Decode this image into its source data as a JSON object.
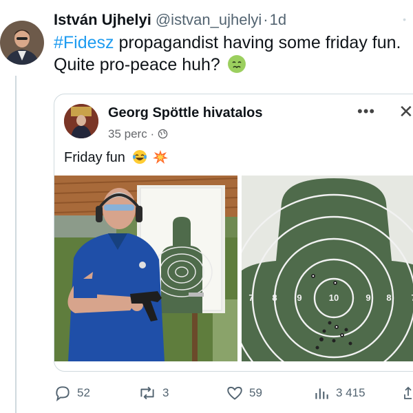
{
  "tweet": {
    "author": "István Ujhelyi",
    "handle": "@istvan_ujhelyi",
    "separator": "·",
    "time": "1d",
    "hashtag": "#Fidesz",
    "text_line": " propagandist having some friday fun. Quite pro-peace huh?",
    "emoji": "nauseated-face-emoji"
  },
  "embedded_post": {
    "author": "Georg Spöttle hivatalos",
    "time": "35 perc",
    "separator": "·",
    "privacy_icon": "globe-icon",
    "text": "Friday fun",
    "emojis": [
      "laughing-tears-emoji",
      "collision-emoji"
    ],
    "more_label": "•••",
    "close_label": "✕"
  },
  "target": {
    "rings_left": [
      "7",
      "8",
      "9"
    ],
    "center": "10",
    "rings_right": [
      "9",
      "8",
      "7"
    ]
  },
  "actions": {
    "replies": "52",
    "reposts": "3",
    "likes": "59",
    "views": "3 415"
  },
  "colors": {
    "hashtag": "#1d9bf0",
    "secondary_text": "#536471",
    "target_green": "#4f6b4b",
    "shirt_blue": "#1f4fa8"
  }
}
